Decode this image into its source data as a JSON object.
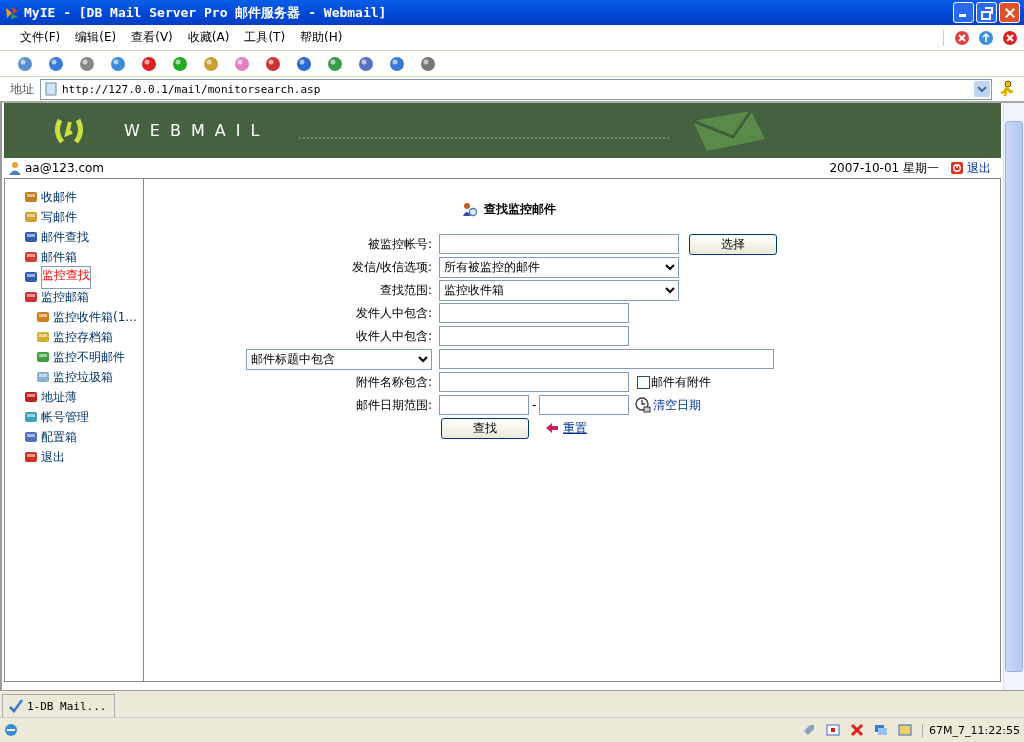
{
  "window": {
    "title": "MyIE - [DB Mail Server Pro 邮件服务器 - Webmail]"
  },
  "menu": [
    "文件(F)",
    "编辑(E)",
    "查看(V)",
    "收藏(A)",
    "工具(T)",
    "帮助(H)"
  ],
  "address": {
    "label": "地址",
    "url": "http://127.0.0.1/mail/monitorsearch.asp"
  },
  "banner": {
    "logo_text": "WEBMAIL"
  },
  "user_bar": {
    "email": "aa@123.com",
    "date": "2007-10-01 星期一",
    "logout": "退出"
  },
  "sidebar": {
    "items": [
      {
        "label": "收邮件",
        "selected": false
      },
      {
        "label": "写邮件",
        "selected": false
      },
      {
        "label": "邮件查找",
        "selected": false
      },
      {
        "label": "邮件箱",
        "selected": false
      },
      {
        "label": "监控查找",
        "selected": true
      },
      {
        "label": "监控邮箱",
        "selected": false,
        "children": [
          {
            "label": "监控收件箱(1...",
            "selected": false
          },
          {
            "label": "监控存档箱",
            "selected": false
          },
          {
            "label": "监控不明邮件",
            "selected": false
          },
          {
            "label": "监控垃圾箱",
            "selected": false
          }
        ]
      },
      {
        "label": "地址薄",
        "selected": false
      },
      {
        "label": "帐号管理",
        "selected": false
      },
      {
        "label": "配置箱",
        "selected": false
      },
      {
        "label": "退出",
        "selected": false
      }
    ]
  },
  "form": {
    "title": "查找监控邮件",
    "rows": [
      {
        "kind": "account",
        "label": "被监控帐号:",
        "button": "选择"
      },
      {
        "kind": "select",
        "label": "发信/收信选项:",
        "value": "所有被监控的邮件"
      },
      {
        "kind": "select",
        "label": "查找范围:",
        "value": "监控收件箱"
      },
      {
        "kind": "text",
        "label": "发件人中包含:"
      },
      {
        "kind": "text",
        "label": "收件人中包含:"
      },
      {
        "kind": "subject",
        "label": "邮件标题中包含"
      },
      {
        "kind": "attachment",
        "label": "附件名称包含:",
        "checkbox": {
          "label": "邮件有附件",
          "checked": false
        }
      },
      {
        "kind": "daterange",
        "label": "邮件日期范围:",
        "separator": "-",
        "link": "清空日期"
      }
    ],
    "submit": "查找",
    "reset": "重置"
  },
  "tabs": [
    {
      "label": "1-DB Mail...",
      "selected": true
    }
  ],
  "status_bar": {
    "time": "67M_7_11:22:55"
  }
}
